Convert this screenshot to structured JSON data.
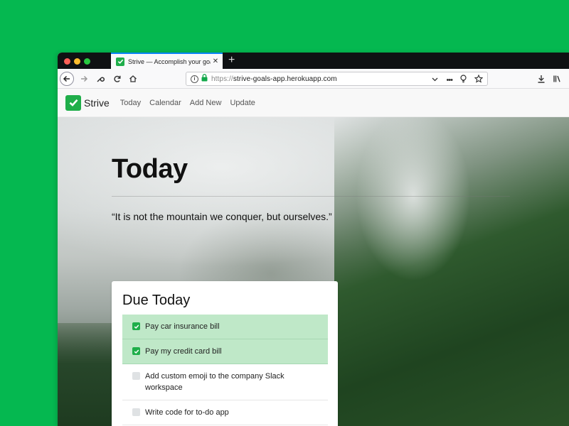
{
  "browser": {
    "tab_title": "Strive — Accomplish your goals",
    "url_prefix": "https://",
    "url_host": "strive-goals-app.herokuapp.com"
  },
  "app": {
    "brand": "Strive",
    "nav": [
      {
        "label": "Today"
      },
      {
        "label": "Calendar"
      },
      {
        "label": "Add New"
      },
      {
        "label": "Update"
      }
    ]
  },
  "main": {
    "title": "Today",
    "quote": "“It is not the mountain we conquer, but ourselves.”"
  },
  "due_today": {
    "heading": "Due Today",
    "tasks": [
      {
        "label": "Pay car insurance bill",
        "done": true
      },
      {
        "label": "Pay my credit card bill",
        "done": true
      },
      {
        "label": "Add custom emoji to the company Slack workspace",
        "done": false
      },
      {
        "label": "Write code for to-do app",
        "done": false
      }
    ]
  },
  "colors": {
    "background": "#05b850",
    "brand": "#1fae4a",
    "done_row": "#bfe8c8"
  }
}
